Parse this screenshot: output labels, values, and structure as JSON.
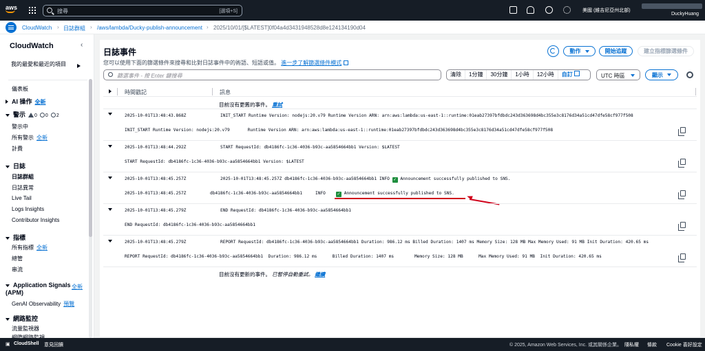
{
  "topbar": {
    "logo": "aws",
    "search_placeholder": "搜尋",
    "search_shortcut": "[選項+S]",
    "region": "美國 (維吉尼亞州北部)",
    "account": "DuckyHuang",
    "icons": [
      "grid-icon",
      "cloudshell-icon",
      "bell-icon",
      "help-icon",
      "gear-icon"
    ]
  },
  "breadcrumb": {
    "items": [
      "CloudWatch",
      "日誌群組",
      "/aws/lambda/Ducky-publish-announcement",
      "2025/10/01/[$LATEST]0f04a4d3431948528d8e124134190d04"
    ]
  },
  "sidebar": {
    "title": "CloudWatch",
    "favorites": "我的最愛和最近的項目",
    "dashboards": "儀表板",
    "ai_ops": "AI 操作",
    "new_label": "全新",
    "alarms": {
      "label": "警示",
      "count_a": "0",
      "count_b": "0",
      "count_c": "2"
    },
    "alarm_items": [
      "警示中",
      "所有警示",
      "計費"
    ],
    "logs": "日誌",
    "log_items": [
      "日誌群組",
      "日誌異常",
      "Live Tail",
      "Logs Insights",
      "Contributor Insights"
    ],
    "metrics": "指標",
    "metric_items": [
      "所有指標",
      "總管",
      "串流"
    ],
    "app_signals": "Application Signals (APM)",
    "genai": "GenAI Observability",
    "preview": "預覽",
    "network": "網路監控",
    "network_items": [
      "流量監視器",
      "網際網路監視"
    ]
  },
  "main": {
    "title": "日誌事件",
    "description": "您可以使用下面的篩選條件來搜尋和比對日誌事件中的術語、短語或值。",
    "learn_more": "進一步了解篩選條件模式",
    "actions": "動作",
    "start_tail": "開始追蹤",
    "create_filter": "建立指標篩選條件",
    "filter_placeholder": "篩選事件 - 按 Enter 鍵搜尋",
    "time_buttons": [
      "清除",
      "1分鐘",
      "30分鐘",
      "1小時",
      "12小時"
    ],
    "custom": "自訂",
    "timezone": "UTC 時區",
    "display": "顯示",
    "col_timestamp": "時間戳記",
    "col_message": "訊息",
    "no_older": "目前沒有更舊的事件。",
    "retry": "重試",
    "no_newer": "目前沒有更新的事件。",
    "auto_paused": "已暫停自動重試。",
    "resume": "繼續"
  },
  "log_rows": [
    {
      "ts": "2025-10-01T13:48:43.868Z",
      "summary": "INIT_START Runtime Version: nodejs:20.v79 Runtime Version ARN: arn:aws:lambda:us-east-1::runtime:01eab27397bfdbdc243d363698d4bc355e3c8176d34a51cd47dfe58cf977f508",
      "detail": "INIT_START Runtime Version: nodejs:20.v79       Runtime Version ARN: arn:aws:lambda:us-east-1::runtime:01eab27397bfdbdc243d363698d4bc355e3c8176d34a51cd47dfe58cf977f508"
    },
    {
      "ts": "2025-10-01T13:48:44.292Z",
      "summary": "START RequestId: db4186fc-1c36-4036-b93c-aa5854664bb1 Version: $LATEST",
      "detail": "START RequestId: db4186fc-1c36-4036-b93c-aa5854664bb1 Version: $LATEST"
    },
    {
      "ts": "2025-10-01T13:48:45.257Z",
      "summary_a": "2025-10-01T13:48:45.257Z db4186fc-1c36-4036-b93c-aa5854664bb1 INFO ",
      "summary_b": " Announcement successfully published to SNS.",
      "detail_ts": "2025-10-01T13:48:45.257Z",
      "detail_id": "db4186fc-1c36-4036-b93c-aa5854664bb1",
      "detail_level": "INFO",
      "detail_msg": " Announcement successfully published to SNS."
    },
    {
      "ts": "2025-10-01T13:48:45.279Z",
      "summary": "END RequestId: db4186fc-1c36-4036-b93c-aa5854664bb1",
      "detail": "END RequestId: db4186fc-1c36-4036-b93c-aa5854664bb1"
    },
    {
      "ts": "2025-10-01T13:48:45.279Z",
      "summary": "REPORT RequestId: db4186fc-1c36-4036-b93c-aa5854664bb1 Duration: 986.12 ms Billed Duration: 1407 ms Memory Size: 128 MB Max Memory Used: 91 MB Init Duration: 420.65 ms",
      "detail": "REPORT RequestId: db4186fc-1c36-4036-b93c-aa5854664bb1  Duration: 986.12 ms      Billed Duration: 1407 ms        Memory Size: 128 MB      Max Memory Used: 91 MB  Init Duration: 420.65 ms"
    }
  ],
  "footer": {
    "cloudshell": "CloudShell",
    "feedback": "意見回饋",
    "copyright": "© 2025, Amazon Web Services, Inc. 或其關係企業。",
    "privacy": "隱私權",
    "terms": "條款",
    "cookies": "Cookie 喜好設定"
  },
  "colors": {
    "accent": "#0972d3",
    "topbar": "#161d26",
    "success": "#1e8e3e",
    "annotation": "#d0021b"
  }
}
